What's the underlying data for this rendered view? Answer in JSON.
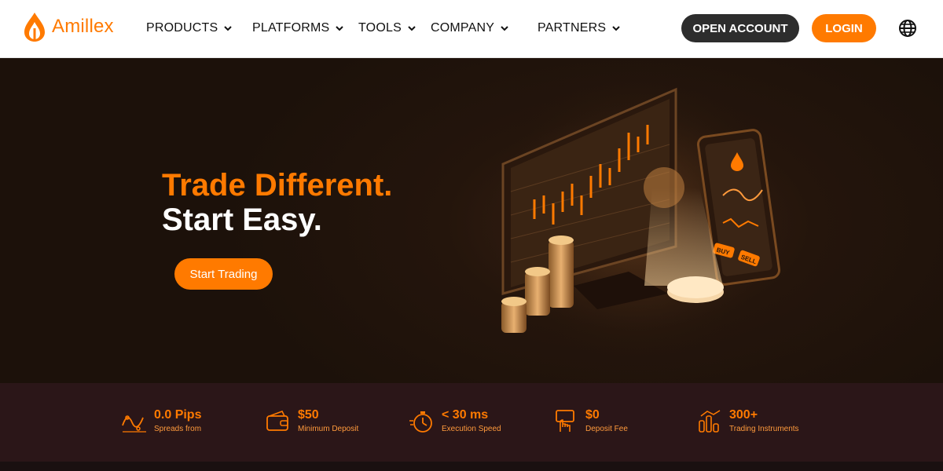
{
  "brand": {
    "name": "Amillex"
  },
  "nav": {
    "items": [
      {
        "label": "PRODUCTS"
      },
      {
        "label": "PLATFORMS"
      },
      {
        "label": "TOOLS"
      },
      {
        "label": "COMPANY"
      },
      {
        "label": "PARTNERS"
      }
    ],
    "open_account": "OPEN ACCOUNT",
    "login": "LOGIN"
  },
  "hero": {
    "headline_line1": "Trade Different.",
    "headline_line2": "Start Easy.",
    "cta": "Start Trading",
    "art_labels": {
      "buy": "BUY",
      "sell": "SELL"
    }
  },
  "stats": [
    {
      "value": "0.0 Pips",
      "label": "Spreads from",
      "icon": "wave-chart-icon"
    },
    {
      "value": "$50",
      "label": "Minimum Deposit",
      "icon": "wallet-icon"
    },
    {
      "value": "< 30 ms",
      "label": "Execution Speed",
      "icon": "stopwatch-icon"
    },
    {
      "value": "$0",
      "label": "Deposit Fee",
      "icon": "hand-card-icon"
    },
    {
      "value": "300+",
      "label": "Trading Instruments",
      "icon": "instruments-icon"
    }
  ],
  "colors": {
    "accent": "#ff7a00",
    "dark_button": "#2d2d2d",
    "hero_bg": "#1c110a",
    "stats_bg": "#2b1618"
  }
}
